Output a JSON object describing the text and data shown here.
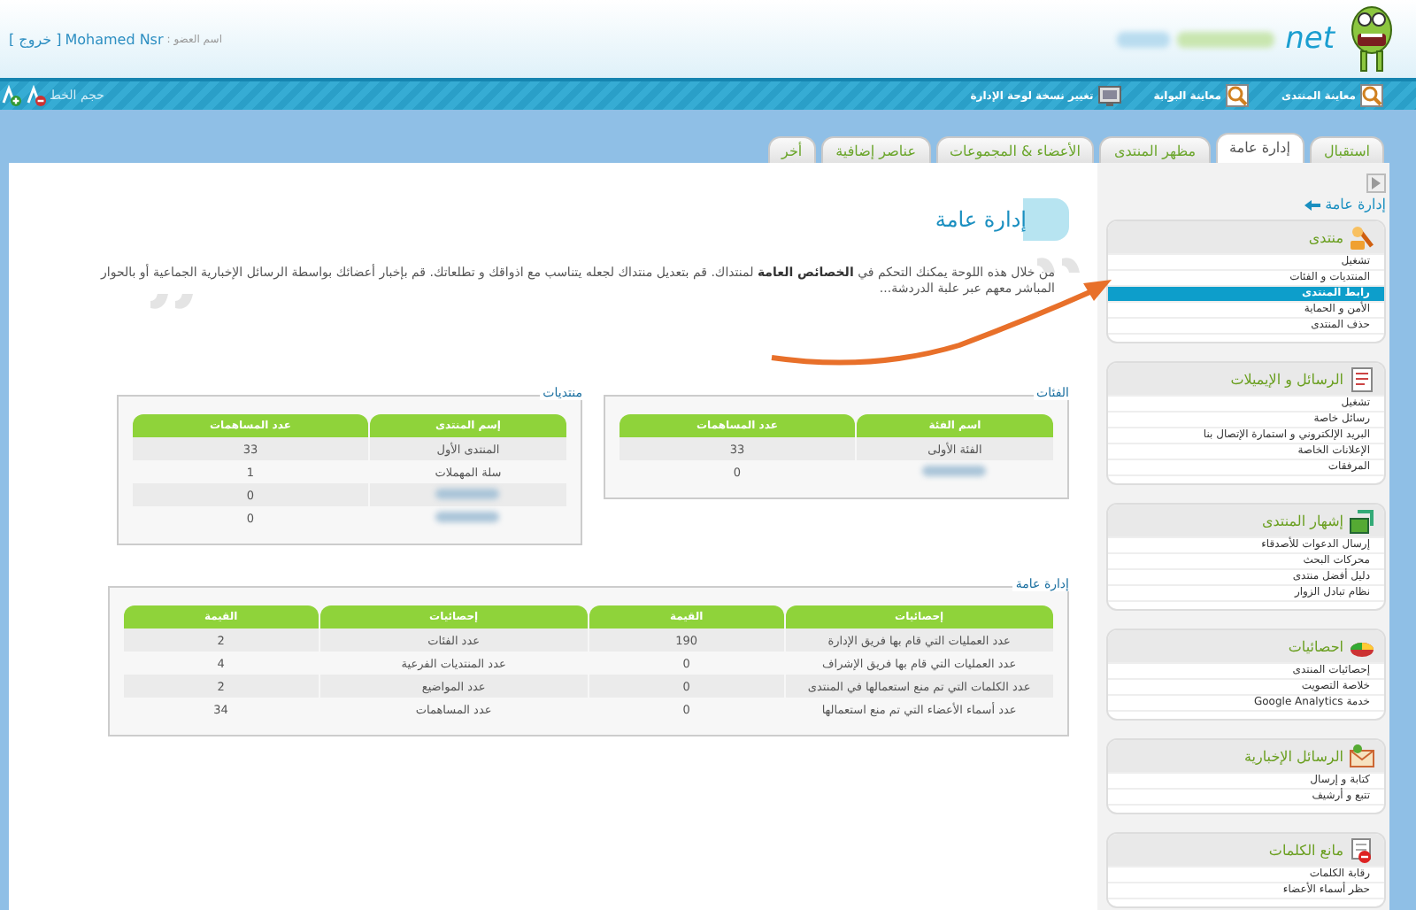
{
  "header": {
    "member_label": "اسم العضو :",
    "member_name": "Mohamed Nsr",
    "logout": "[ خروج ]",
    "logo_suffix": "net"
  },
  "toolbar": {
    "links": [
      "معاينة المنتدى",
      "معاينة البوابة",
      "تغيير نسخة لوحة الإدارة"
    ],
    "font_size_label": "حجم الخط"
  },
  "tabs": [
    {
      "label": "استقبال",
      "selected": false
    },
    {
      "label": "إدارة عامة",
      "selected": true
    },
    {
      "label": "مظهر المنتدى",
      "selected": false
    },
    {
      "label": "الأعضاء & المجموعات",
      "selected": false
    },
    {
      "label": "عناصر إضافية",
      "selected": false
    },
    {
      "label": "أخر",
      "selected": false
    }
  ],
  "sidebar": {
    "back_link": "إدارة عامة",
    "sections": [
      {
        "title": "منتدى",
        "items": [
          {
            "label": "تشغيل",
            "selected": false
          },
          {
            "label": "المنتديات و الفئات",
            "selected": false
          },
          {
            "label": "رابط المنتدى",
            "selected": true
          },
          {
            "label": "الأمن و الحماية",
            "selected": false
          },
          {
            "label": "حذف المنتدى",
            "selected": false
          }
        ]
      },
      {
        "title": "الرسائل و الإيميلات",
        "items": [
          {
            "label": "تشغيل",
            "selected": false
          },
          {
            "label": "رسائل خاصة",
            "selected": false
          },
          {
            "label": "البريد الإلكتروني و استمارة الإتصال بنا",
            "selected": false
          },
          {
            "label": "الإعلانات الخاصة",
            "selected": false
          },
          {
            "label": "المرفقات",
            "selected": false
          }
        ]
      },
      {
        "title": "إشهار المنتدى",
        "items": [
          {
            "label": "إرسال الدعوات للأصدقاء",
            "selected": false
          },
          {
            "label": "محركات البحث",
            "selected": false
          },
          {
            "label": "دليل أفضل منتدى",
            "selected": false
          },
          {
            "label": "نظام تبادل الزوار",
            "selected": false
          }
        ]
      },
      {
        "title": "احصائيات",
        "items": [
          {
            "label": "إحصائيات المنتدى",
            "selected": false
          },
          {
            "label": "خلاصة التصويت",
            "selected": false
          },
          {
            "label": "خدمة Google Analytics",
            "selected": false
          }
        ]
      },
      {
        "title": "الرسائل الإخبارية",
        "items": [
          {
            "label": "كتابة و إرسال",
            "selected": false
          },
          {
            "label": "تتبع و أرشيف",
            "selected": false
          }
        ]
      },
      {
        "title": "مانع الكلمات",
        "items": [
          {
            "label": "رقابة الكلمات",
            "selected": false
          },
          {
            "label": "حظر أسماء الأعضاء",
            "selected": false
          }
        ]
      }
    ]
  },
  "main": {
    "title": "إدارة عامة",
    "intro": "من خلال هذه اللوحة يمكنك التحكم في **الخصائص العامة** لمنتداك. قم بتعديل منتداك لجعله يتناسب مع اذواقك و تطلعاتك. قم بإخبار أعضائك بواسطة الرسائل الإخبارية الجماعية أو بالحوار المباشر معهم عبر علبة الدردشة...",
    "tables": [
      {
        "title": "الفئات",
        "columns": [
          "اسم الفئة",
          "عدد المساهمات"
        ],
        "rows": [
          [
            "الفئة الأولى",
            "33"
          ],
          [
            {
              "kind": "blurred"
            },
            "0"
          ]
        ]
      },
      {
        "title": "منتديات",
        "columns": [
          "إسم المنتدى",
          "عدد المساهمات"
        ],
        "rows": [
          [
            "المنتدى الأول",
            "33"
          ],
          [
            "سلة المهملات",
            "1"
          ],
          [
            {
              "kind": "blurred"
            },
            "0"
          ],
          [
            {
              "kind": "blurred"
            },
            "0"
          ]
        ]
      },
      {
        "title": "إدارة عامة",
        "columns": [
          "إحصائيات",
          "القيمة",
          "إحصائيات",
          "القيمة"
        ],
        "rows": [
          [
            "عدد العمليات التي قام بها فريق الإدارة",
            "190",
            "عدد الفئات",
            "2"
          ],
          [
            "عدد العمليات التي قام بها فريق الإشراف",
            "0",
            "عدد المنتديات الفرعية",
            "4"
          ],
          [
            "عدد الكلمات التي تم منع استعمالها في المنتدى",
            "0",
            "عدد المواضيع",
            "2"
          ],
          [
            "عدد أسماء الأعضاء التي تم منع استعمالها",
            "0",
            "عدد المساهمات",
            "34"
          ]
        ]
      }
    ]
  }
}
